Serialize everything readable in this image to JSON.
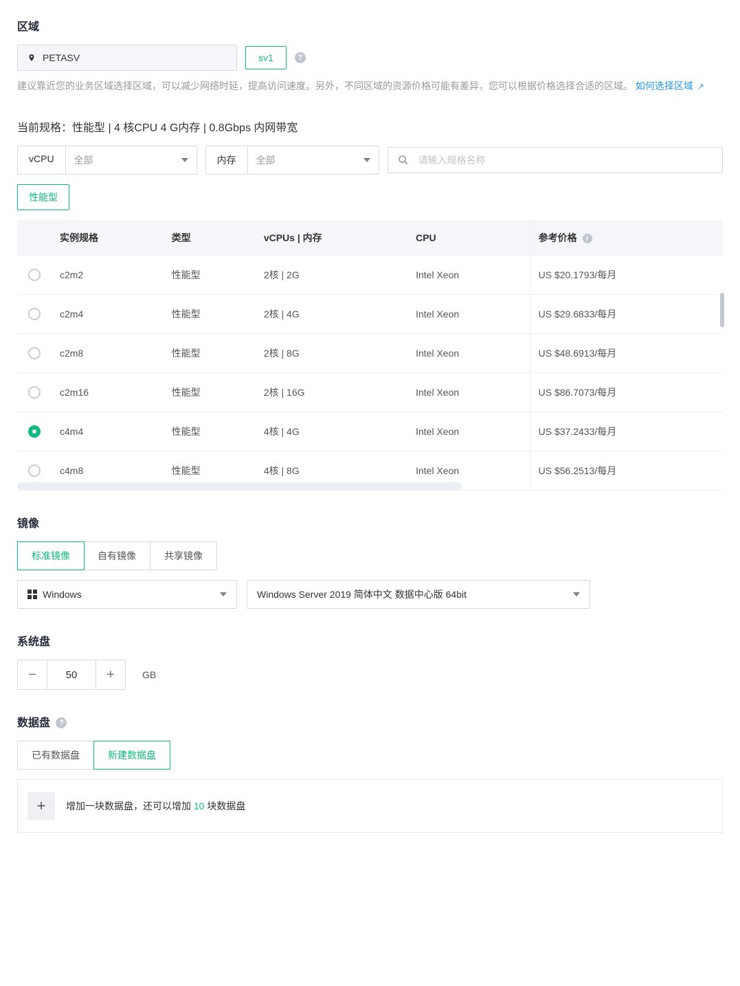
{
  "region": {
    "title": "区域",
    "selected": "PETASV",
    "zone": "sv1",
    "hint": "建议靠近您的业务区域选择区域，可以减少网络时延，提高访问速度。另外，不同区域的资源价格可能有差异，您可以根据价格选择合适的区域。",
    "help_link": "如何选择区域"
  },
  "spec": {
    "summary": "当前规格：性能型 | 4 核CPU 4 G内存 | 0.8Gbps 内网带宽",
    "filters": {
      "vcpu_label": "vCPU",
      "vcpu_value": "全部",
      "mem_label": "内存",
      "mem_value": "全部",
      "search_placeholder": "请输入规格名称"
    },
    "type_button": "性能型",
    "columns": {
      "name": "实例规格",
      "type": "类型",
      "vcpu_mem": "vCPUs | 内存",
      "cpu": "CPU",
      "price": "参考价格"
    },
    "rows": [
      {
        "name": "c2m2",
        "type": "性能型",
        "vcpu_mem": "2核 | 2G",
        "cpu": "Intel Xeon",
        "price": "US $20.1793/每月",
        "selected": false
      },
      {
        "name": "c2m4",
        "type": "性能型",
        "vcpu_mem": "2核 | 4G",
        "cpu": "Intel Xeon",
        "price": "US $29.6833/每月",
        "selected": false
      },
      {
        "name": "c2m8",
        "type": "性能型",
        "vcpu_mem": "2核 | 8G",
        "cpu": "Intel Xeon",
        "price": "US $48.6913/每月",
        "selected": false
      },
      {
        "name": "c2m16",
        "type": "性能型",
        "vcpu_mem": "2核 | 16G",
        "cpu": "Intel Xeon",
        "price": "US $86.7073/每月",
        "selected": false
      },
      {
        "name": "c4m4",
        "type": "性能型",
        "vcpu_mem": "4核 | 4G",
        "cpu": "Intel Xeon",
        "price": "US $37.2433/每月",
        "selected": true
      },
      {
        "name": "c4m8",
        "type": "性能型",
        "vcpu_mem": "4核 | 8G",
        "cpu": "Intel Xeon",
        "price": "US $56.2513/每月",
        "selected": false
      }
    ]
  },
  "image": {
    "title": "镜像",
    "tabs": [
      "标准镜像",
      "自有镜像",
      "共享镜像"
    ],
    "active_tab": 0,
    "os": "Windows",
    "version": "Windows Server 2019 简体中文 数据中心版 64bit"
  },
  "system_disk": {
    "title": "系统盘",
    "size": "50",
    "unit": "GB"
  },
  "data_disk": {
    "title": "数据盘",
    "tabs": [
      "已有数据盘",
      "新建数据盘"
    ],
    "active_tab": 1,
    "add_text_pre": "增加一块数据盘，还可以增加 ",
    "add_count": "10",
    "add_text_post": " 块数据盘"
  }
}
